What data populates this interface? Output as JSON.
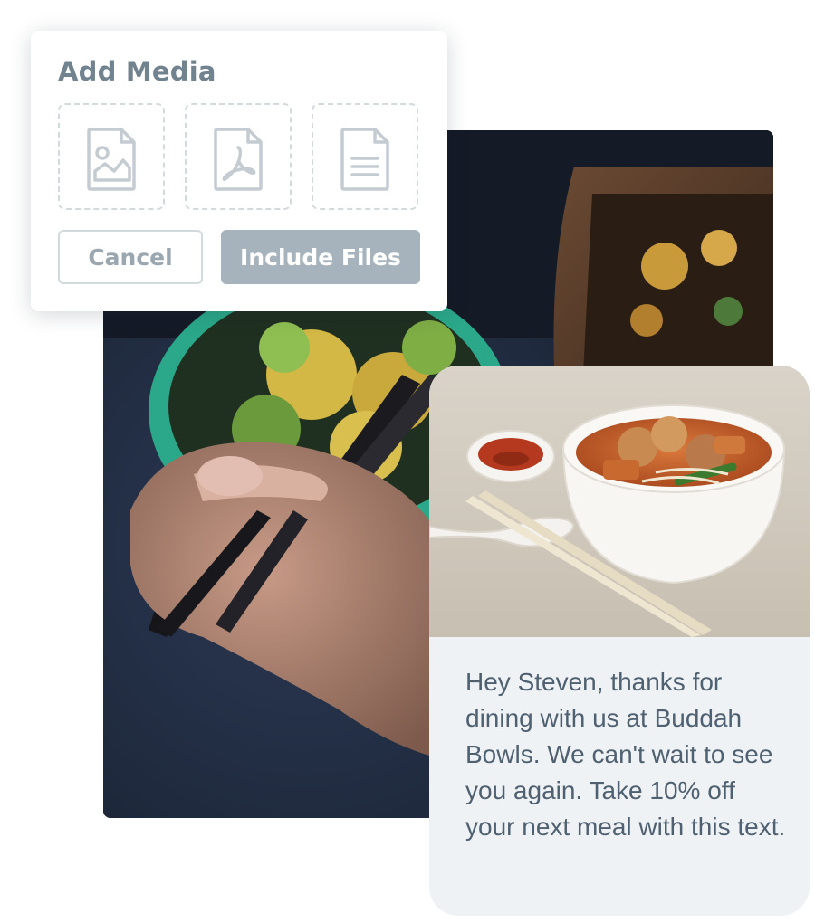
{
  "dialog": {
    "title": "Add Media",
    "tiles": [
      {
        "type": "image",
        "icon": "image-file-icon"
      },
      {
        "type": "pdf",
        "icon": "pdf-file-icon"
      },
      {
        "type": "document",
        "icon": "document-file-icon"
      }
    ],
    "cancel_label": "Cancel",
    "include_label": "Include Files"
  },
  "message": {
    "text": "Hey Steven, thanks for dining with us at Buddah Bowls. We can't wait to see you again. Take 10% off your next meal with this text."
  },
  "colors": {
    "title": "#728390",
    "tile_border": "#d3dade",
    "include_button": "#a6b3bc",
    "bubble_bg": "#eff2f5",
    "message_text": "#4f6070"
  }
}
